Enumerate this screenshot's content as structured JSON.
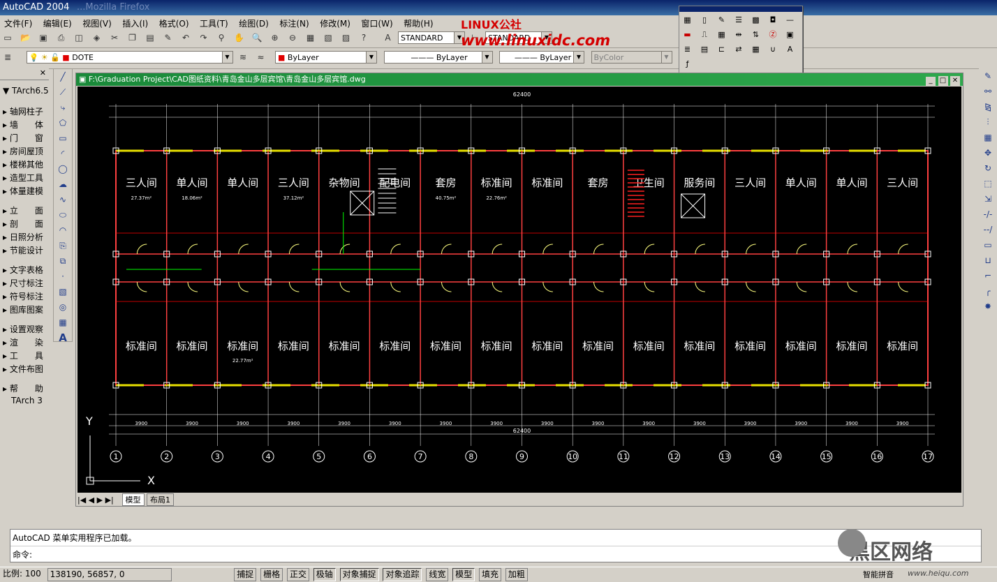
{
  "window": {
    "title": "AutoCAD 2004",
    "ghost_title": "...Mozilla Firefox"
  },
  "watermark": {
    "top_logo": "LINUX公社",
    "top_url": "www.linuxidc.com",
    "bottom_logo": "黑区网络",
    "bottom_url": "www.heiqu.com"
  },
  "menubar": [
    "文件(F)",
    "编辑(E)",
    "视图(V)",
    "插入(I)",
    "格式(O)",
    "工具(T)",
    "绘图(D)",
    "标注(N)",
    "修改(M)",
    "窗口(W)",
    "帮助(H)"
  ],
  "toolbar": {
    "text_style": "STANDARD",
    "dim_style": "STANDARD",
    "layer": "DOTE",
    "color": "ByLayer",
    "linetype": "ByLayer",
    "lineweight": "ByLayer",
    "plotstyle": "ByColor"
  },
  "tarch_menu": {
    "header": "TArch6.5",
    "groups": [
      [
        "轴网柱子",
        "墙　　体",
        "门　　窗",
        "房间屋顶",
        "楼梯其他",
        "造型工具",
        "体量建模"
      ],
      [
        "立　　面",
        "剖　　面",
        "日照分析",
        "节能设计"
      ],
      [
        "文字表格",
        "尺寸标注",
        "符号标注",
        "图库图案"
      ],
      [
        "设置观察",
        "渲　　染",
        "工　　具",
        "文件布图"
      ],
      [
        "帮　　助"
      ]
    ],
    "footer": "TArch 3"
  },
  "drawing": {
    "path": "F:\\Graduation Project\\CAD图纸资料\\青岛金山多层宾馆\\青岛金山多层宾馆.dwg",
    "total_dim": "62400",
    "top_rooms": [
      "三人间",
      "单人间",
      "单人间",
      "三人间",
      "杂物间",
      "配电间",
      "套房",
      "标准间",
      "标准间",
      "套房",
      "卫生间",
      "服务间",
      "三人间",
      "单人间",
      "单人间",
      "三人间"
    ],
    "top_areas": [
      "27.37m²",
      "18.06m²",
      "",
      "37.12m²",
      "",
      "",
      "40.75m²",
      "22.76m²"
    ],
    "bottom_rooms": [
      "标准间",
      "标准间",
      "标准间",
      "标准间",
      "标准间",
      "标准间",
      "标准间",
      "标准间",
      "标准间",
      "标准间",
      "标准间",
      "标准间",
      "标准间",
      "标准间",
      "标准间",
      "标准间"
    ],
    "bottom_area": "22.77m²",
    "axis_labels": [
      "1",
      "2",
      "3",
      "4",
      "5",
      "6",
      "7",
      "8",
      "9",
      "10",
      "11",
      "12",
      "13",
      "14",
      "15",
      "16",
      "17"
    ],
    "bay_dims": [
      "3900",
      "3900",
      "3900",
      "3900",
      "3900",
      "3900",
      "3900",
      "3900",
      "3900",
      "3900",
      "3900",
      "3900",
      "3900",
      "3900",
      "3900",
      "3900"
    ],
    "ucs_x": "X",
    "ucs_y": "Y"
  },
  "tabs": {
    "model": "模型",
    "layout": "布局1"
  },
  "command": {
    "line1": "AutoCAD 菜单实用程序已加载。",
    "prompt": "命令:"
  },
  "status": {
    "scale": "比例: 100",
    "coords": "138190, 56857, 0",
    "buttons": [
      "捕捉",
      "栅格",
      "正交",
      "极轴",
      "对象捕捉",
      "对象追踪",
      "线宽",
      "模型",
      "填充",
      "加粗"
    ],
    "ime": "智能拼音"
  }
}
